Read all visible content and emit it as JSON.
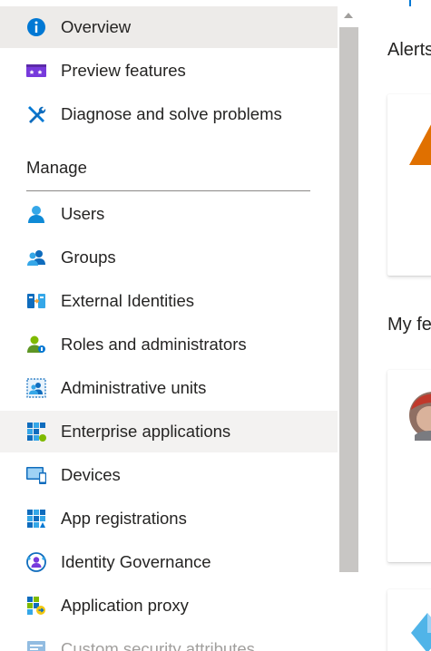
{
  "sidebar": {
    "items": [
      {
        "label": "Overview",
        "icon": "info-icon"
      },
      {
        "label": "Preview features",
        "icon": "preview-features-icon"
      },
      {
        "label": "Diagnose and solve problems",
        "icon": "wrench-screwdriver-icon"
      }
    ],
    "section_heading": "Manage",
    "manage_items": [
      {
        "label": "Users",
        "icon": "user-icon"
      },
      {
        "label": "Groups",
        "icon": "groups-icon"
      },
      {
        "label": "External Identities",
        "icon": "external-identities-icon"
      },
      {
        "label": "Roles and administrators",
        "icon": "roles-icon"
      },
      {
        "label": "Administrative units",
        "icon": "administrative-units-icon"
      },
      {
        "label": "Enterprise applications",
        "icon": "enterprise-apps-icon"
      },
      {
        "label": "Devices",
        "icon": "devices-icon"
      },
      {
        "label": "App registrations",
        "icon": "app-registrations-icon"
      },
      {
        "label": "Identity Governance",
        "icon": "identity-governance-icon"
      },
      {
        "label": "Application proxy",
        "icon": "application-proxy-icon"
      },
      {
        "label": "Custom security attributes",
        "icon": "custom-security-attributes-icon"
      }
    ]
  },
  "content": {
    "alerts_heading": "Alerts",
    "my_feed_heading": "My fe"
  },
  "colors": {
    "accent": "#0078d4",
    "selected_bg": "#edebe9",
    "warning": "#e07000"
  }
}
